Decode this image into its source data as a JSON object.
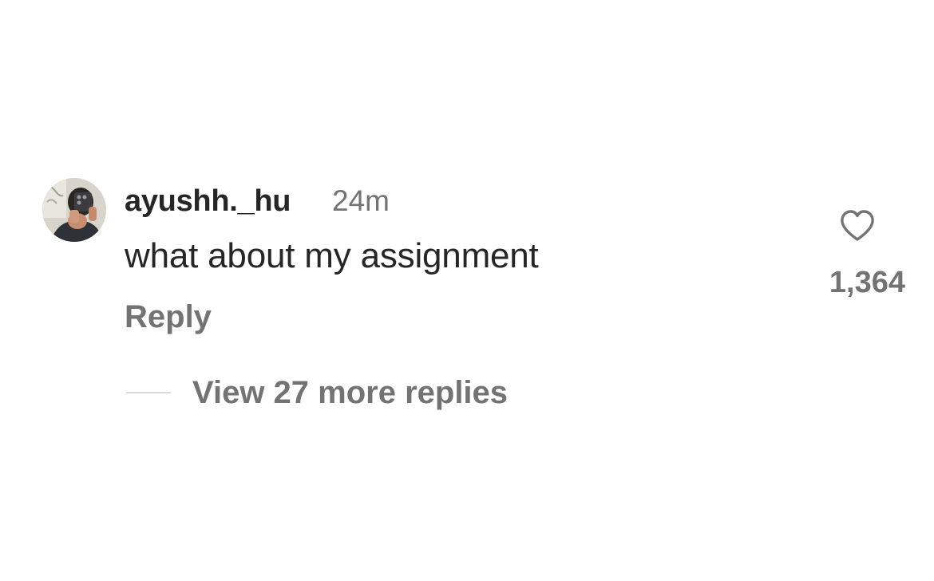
{
  "comment": {
    "avatar_icon": "user-avatar-photo",
    "username": "ayushh._hu",
    "timestamp": "24m",
    "text": "what about my assignment",
    "reply_label": "Reply",
    "like_icon": "heart-outline-icon",
    "like_count": "1,364",
    "view_replies_label": "View 27 more replies"
  },
  "colors": {
    "primary_text": "#262626",
    "secondary_text": "#737373",
    "divider": "#dbdbdb",
    "background": "#ffffff"
  }
}
